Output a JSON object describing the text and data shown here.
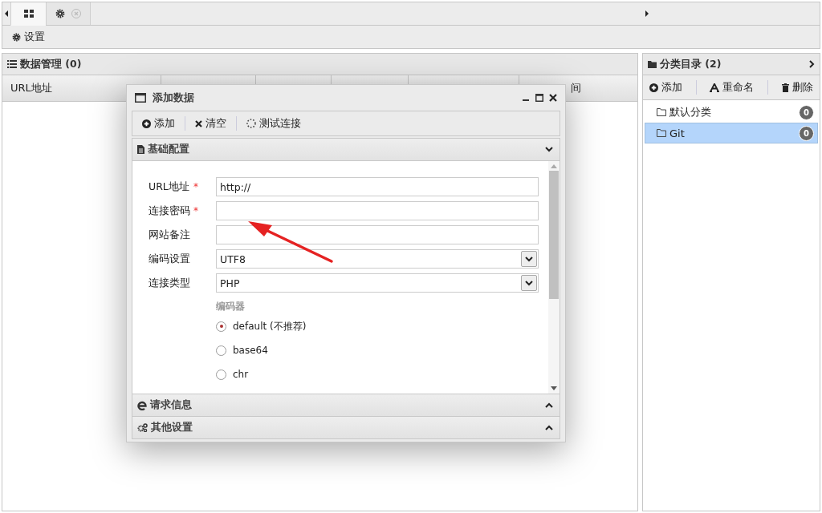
{
  "tabs": [
    {
      "kind": "grid",
      "selected": true
    },
    {
      "kind": "settings",
      "selected": false,
      "closable": true
    }
  ],
  "toolbar": {
    "settings_label": "设置"
  },
  "data_panel": {
    "title": "数据管理 (0)",
    "columns": [
      {
        "label": "URL地址"
      },
      {
        "label": "间"
      }
    ]
  },
  "category_panel": {
    "title": "分类目录 (2)",
    "actions": [
      {
        "kind": "add",
        "label": "添加"
      },
      {
        "kind": "rename",
        "label": "重命名"
      },
      {
        "kind": "delete",
        "label": "删除"
      }
    ],
    "items": [
      {
        "name": "默认分类",
        "count": "0",
        "selected": false
      },
      {
        "name": "Git",
        "count": "0",
        "selected": true
      }
    ]
  },
  "dialog": {
    "title": "添加数据",
    "actions": [
      {
        "kind": "add",
        "label": "添加"
      },
      {
        "kind": "clear",
        "label": "清空"
      },
      {
        "kind": "test",
        "label": "测试连接"
      }
    ],
    "sections": [
      {
        "kind": "basic",
        "title": "基础配置",
        "expanded": true
      },
      {
        "kind": "request",
        "title": "请求信息",
        "expanded": false
      },
      {
        "kind": "other",
        "title": "其他设置",
        "expanded": false
      }
    ],
    "fields": [
      {
        "kind": "text",
        "label": "URL地址",
        "required_mark": "*",
        "value": "http://"
      },
      {
        "kind": "text",
        "label": "连接密码",
        "required_mark": "*"
      },
      {
        "kind": "text",
        "label": "网站备注"
      },
      {
        "kind": "select",
        "label": "编码设置",
        "value": "UTF8"
      },
      {
        "kind": "select",
        "label": "连接类型",
        "value": "PHP"
      }
    ],
    "encoder": {
      "label": "编码器",
      "options": [
        {
          "label": "default (不推荐)",
          "selected": true
        },
        {
          "label": "base64",
          "selected": false
        },
        {
          "label": "chr",
          "selected": false
        }
      ]
    }
  }
}
